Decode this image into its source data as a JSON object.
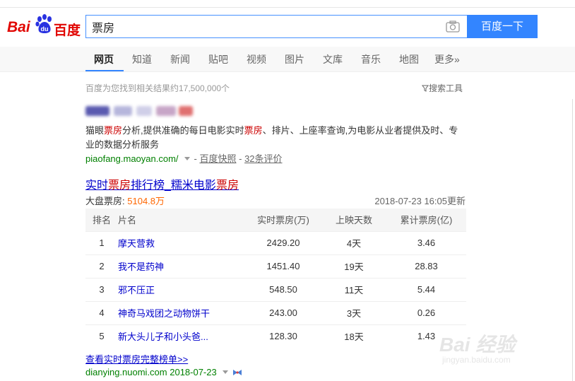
{
  "header": {
    "logo_text_latin": "Bai",
    "logo_text_cn": "百度",
    "search_value": "票房",
    "search_button": "百度一下",
    "camera_icon": "camera-icon"
  },
  "tabs": [
    {
      "label": "网页",
      "active": true
    },
    {
      "label": "知道"
    },
    {
      "label": "新闻"
    },
    {
      "label": "贴吧"
    },
    {
      "label": "视频"
    },
    {
      "label": "图片"
    },
    {
      "label": "文库"
    },
    {
      "label": "音乐"
    },
    {
      "label": "地图"
    },
    {
      "label": "更多»"
    }
  ],
  "summary": {
    "result_count": "百度为您找到相关结果约17,500,000个",
    "tools_label": "搜索工具"
  },
  "result1": {
    "desc_parts": [
      "猫眼",
      "票房",
      "分析,提供准确的每日电影实时",
      "票房",
      "、排片、上座率查询,为电影从业者提供及时、专业的数据分析服务"
    ],
    "url": "piaofang.maoyan.com/",
    "snapshot": "百度快照",
    "reviews": "32条评价"
  },
  "result2": {
    "title_parts": [
      "实时",
      "票房",
      "排行榜_糯米电影",
      "票房"
    ],
    "dapan_label": "大盘票房:",
    "dapan_value": "5104.8万",
    "updated": "2018-07-23 16:05更新",
    "table": {
      "headers": [
        "排名",
        "片名",
        "实时票房(万)",
        "上映天数",
        "累计票房(亿)"
      ],
      "rows": [
        [
          "1",
          "摩天营救",
          "2429.20",
          "4天",
          "3.46"
        ],
        [
          "2",
          "我不是药神",
          "1451.40",
          "19天",
          "28.83"
        ],
        [
          "3",
          "邪不压正",
          "548.50",
          "11天",
          "5.44"
        ],
        [
          "4",
          "神奇马戏团之动物饼干",
          "243.00",
          "3天",
          "0.26"
        ],
        [
          "5",
          "新大头儿子和小头爸...",
          "128.30",
          "18天",
          "1.43"
        ]
      ]
    },
    "more_link": "查看实时票房完整榜单>>",
    "url": "dianying.nuomi.com 2018-07-23"
  },
  "watermark": {
    "brand": "Bai 经验",
    "site": "jingyan.baidu.com"
  },
  "colors": {
    "accent": "#3385ff",
    "brand_red": "#e10602",
    "link": "#0000cc",
    "url_green": "#008000",
    "highlight_red": "#cc0000",
    "orange": "#ff6600"
  }
}
